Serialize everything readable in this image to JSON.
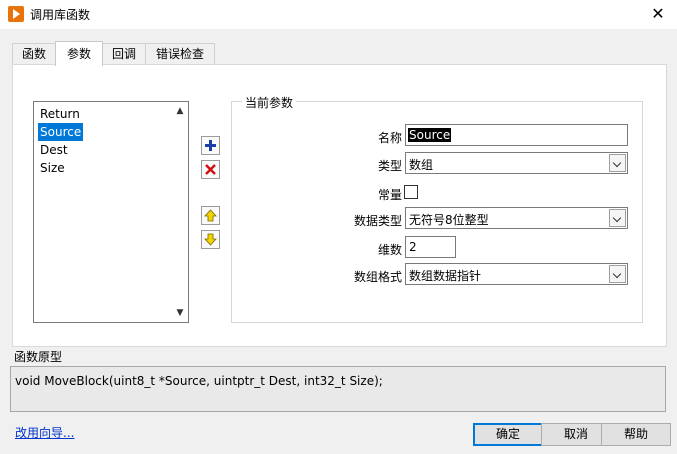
{
  "window": {
    "title": "调用库函数",
    "close_glyph": "✕"
  },
  "tabs": [
    {
      "label": "函数"
    },
    {
      "label": "参数"
    },
    {
      "label": "回调"
    },
    {
      "label": "错误检查"
    }
  ],
  "param_list": {
    "items": [
      "Return",
      "Source",
      "Dest",
      "Size"
    ],
    "selected_index": 1
  },
  "current_params": {
    "group_title": "当前参数",
    "name_label": "名称",
    "name_value": "Source",
    "type_label": "类型",
    "type_value": "数组",
    "constant_label": "常量",
    "constant_checked": false,
    "datatype_label": "数据类型",
    "datatype_value": "无符号8位整型",
    "dims_label": "维数",
    "dims_value": "2",
    "array_format_label": "数组格式",
    "array_format_value": "数组数据指针"
  },
  "prototype": {
    "label": "函数原型",
    "text": "void  MoveBlock(uint8_t *Source, uintptr_t Dest, int32_t Size);"
  },
  "footer": {
    "link": "改用向导...",
    "ok": "确定",
    "cancel": "取消",
    "help": "帮助"
  },
  "colors": {
    "accent": "#0078d7",
    "link": "#0033cc",
    "add": "#1a3fa8",
    "remove": "#d01010",
    "arrow": "#e6c300"
  }
}
